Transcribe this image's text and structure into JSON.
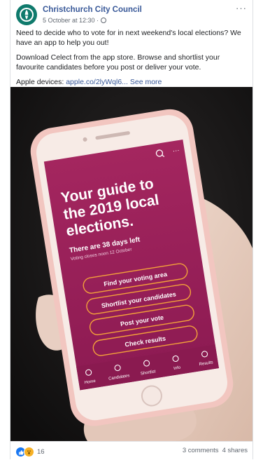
{
  "post": {
    "page_name": "Christchurch City Council",
    "timestamp": "5 October at 12:30 ·",
    "text1": "Need to decide who to vote for in next weekend's local elections? We have an app to help you out!",
    "text2": "Download Celect from the app store. Browse and shortlist your favourite candidates before you post or deliver your vote.",
    "apple_label": "Apple devices: ",
    "apple_link": "apple.co/2lyWql6...",
    "see_more": "See more",
    "more_menu": "···"
  },
  "app": {
    "title": "Your guide to the 2019 local elections.",
    "days_left": "There are 38 days left",
    "voting_closes": "Voting closes noon 12 October",
    "buttons": [
      "Find your voting area",
      "Shortlist your candidates",
      "Post your vote",
      "Check results"
    ],
    "nav": [
      "Home",
      "Candidates",
      "Shortlist",
      "Info",
      "Results"
    ]
  },
  "footer": {
    "reaction_count": "16",
    "comments": "3 comments",
    "shares": "4 shares"
  },
  "colors": {
    "brand_teal": "#0f7a6c",
    "app_magenta": "#9a1f5b",
    "app_button_border": "#f3a13a",
    "link_blue": "#385898"
  }
}
